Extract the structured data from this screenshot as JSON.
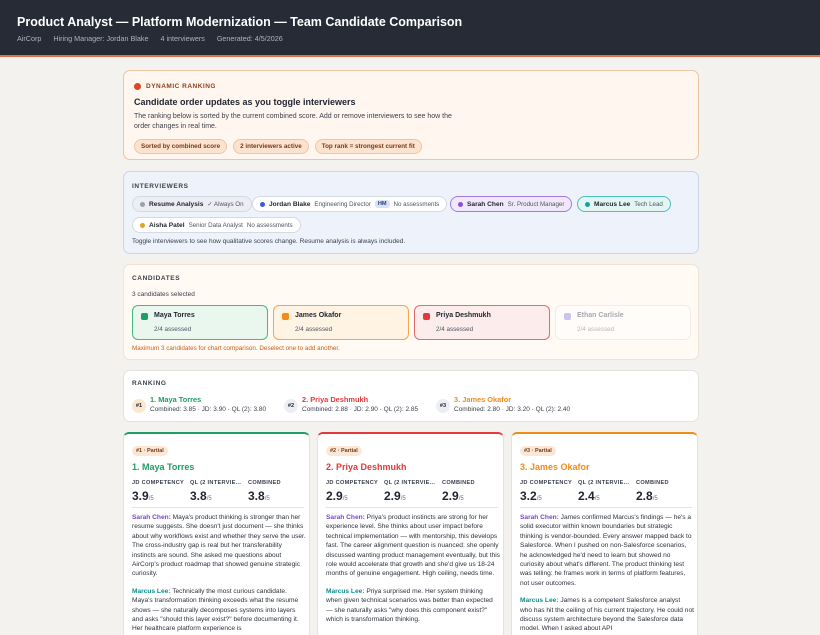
{
  "header": {
    "title": "Product Analyst — Platform Modernization — Team Candidate Comparison",
    "company": "AirCorp",
    "hiring_manager": "Hiring Manager: Jordan Blake",
    "interviewers": "4 interviewers",
    "generated": "Generated: 4/5/2026"
  },
  "dynamic": {
    "kicker": "DYNAMIC RANKING",
    "heading": "Candidate order updates as you toggle interviewers",
    "description": "The ranking below is sorted by the current combined score. Add or remove interviewers to see how the order changes in real time.",
    "chips": [
      "Sorted by combined score",
      "2 interviewers active",
      "Top rank = strongest current fit"
    ]
  },
  "interviewers": {
    "label": "INTERVIEWERS",
    "items": [
      {
        "name": "Resume Analysis",
        "role": "✓ Always On",
        "color": "#9aa0ad"
      },
      {
        "name": "Jordan Blake",
        "role": "Engineering Director",
        "badge": "HM",
        "status": "No assessments",
        "color": "#3b5bd9"
      },
      {
        "name": "Sarah Chen",
        "role": "Sr. Product Manager",
        "color": "#8a4fd6"
      },
      {
        "name": "Marcus Lee",
        "role": "Tech Lead",
        "color": "#14a3a3"
      },
      {
        "name": "Aisha Patel",
        "role": "Senior Data Analyst",
        "status": "No assessments",
        "color": "#e2a321"
      }
    ],
    "note": "Toggle interviewers to see how qualitative scores change. Resume analysis is always included."
  },
  "candidates": {
    "label": "CANDIDATES",
    "selected_text": "3 candidates selected",
    "items": [
      {
        "name": "Maya Torres",
        "assessed": "2/4 assessed",
        "color": "#1f9d63"
      },
      {
        "name": "James Okafor",
        "assessed": "2/4 assessed",
        "color": "#f08c1a"
      },
      {
        "name": "Priya Deshmukh",
        "assessed": "2/4 assessed",
        "color": "#e23a3a"
      },
      {
        "name": "Ethan Carlisle",
        "assessed": "2/4 assessed",
        "color": "#b9b4e8"
      }
    ],
    "warning": "Maximum 3 candidates for chart comparison. Deselect one to add another."
  },
  "ranking": {
    "label": "RANKING",
    "items": [
      {
        "badge": "#1",
        "name": "1. Maya Torres",
        "scores": "Combined: 3.85 · JD: 3.90 · QL (2): 3.80",
        "color": "#1f9d63"
      },
      {
        "badge": "#2",
        "name": "2. Priya Deshmukh",
        "scores": "Combined: 2.88 · JD: 2.90 · QL (2): 2.85",
        "color": "#e23a3a"
      },
      {
        "badge": "#3",
        "name": "3. James Okafor",
        "scores": "Combined: 2.80 · JD: 3.20 · QL (2): 2.40",
        "color": "#f08c1a"
      }
    ]
  },
  "score_labels": [
    "JD COMPETENCY",
    "QL (2 INTERVIE...",
    "COMBINED"
  ],
  "score_unit": "/5",
  "details": [
    {
      "tag": "#1 · Partial",
      "name": "1. Maya Torres",
      "color": "#1f9d63",
      "scores": [
        "3.9",
        "3.8",
        "3.8"
      ],
      "notes": [
        {
          "who": "Sarah Chen:",
          "text": " Maya's product thinking is stronger than her resume suggests. She doesn't just document — she thinks about why workflows exist and whether they serve the user. The cross-industry gap is real but her transferability instincts are sound. She asked me questions about AirCorp's product roadmap that showed genuine strategic curiosity."
        },
        {
          "who": "Marcus Lee:",
          "text": " Technically the most curious candidate. Maya's transformation thinking exceeds what the resume shows — she naturally decomposes systems into layers and asks \"should this layer exist?\" before documenting it. Her healthcare platform experience is"
        }
      ]
    },
    {
      "tag": "#2 · Partial",
      "name": "2. Priya Deshmukh",
      "color": "#e23a3a",
      "scores": [
        "2.9",
        "2.9",
        "2.9"
      ],
      "notes": [
        {
          "who": "Sarah Chen:",
          "text": " Priya's product instincts are strong for her experience level. She thinks about user impact before technical implementation — with mentorship, this develops fast. The career alignment question is nuanced: she openly discussed wanting product management eventually, but this role would accelerate that growth and she'd give us 18-24 months of genuine engagement. High ceiling, needs time."
        },
        {
          "who": "Marcus Lee:",
          "text": " Priya surprised me. Her system thinking when given technical scenarios was better than expected — she naturally asks \"why does this component exist?\" which is transformation thinking."
        }
      ]
    },
    {
      "tag": "#3 · Partial",
      "name": "3. James Okafor",
      "color": "#f08c1a",
      "scores": [
        "3.2",
        "2.4",
        "2.8"
      ],
      "notes": [
        {
          "who": "Sarah Chen:",
          "text": " James confirmed Marcus's findings — he's a solid executor within known boundaries but strategic thinking is vendor-bounded. Every answer mapped back to Salesforce. When I pushed on non-Salesforce scenarios, he acknowledged he'd need to learn but showed no curiosity about what's different. The product thinking test was telling: he frames work in terms of platform features, not user outcomes."
        },
        {
          "who": "Marcus Lee:",
          "text": " James is a competent Salesforce analyst who has hit the ceiling of his current trajectory. He could not discuss system architecture beyond the Salesforce data model. When I asked about API"
        }
      ]
    }
  ]
}
